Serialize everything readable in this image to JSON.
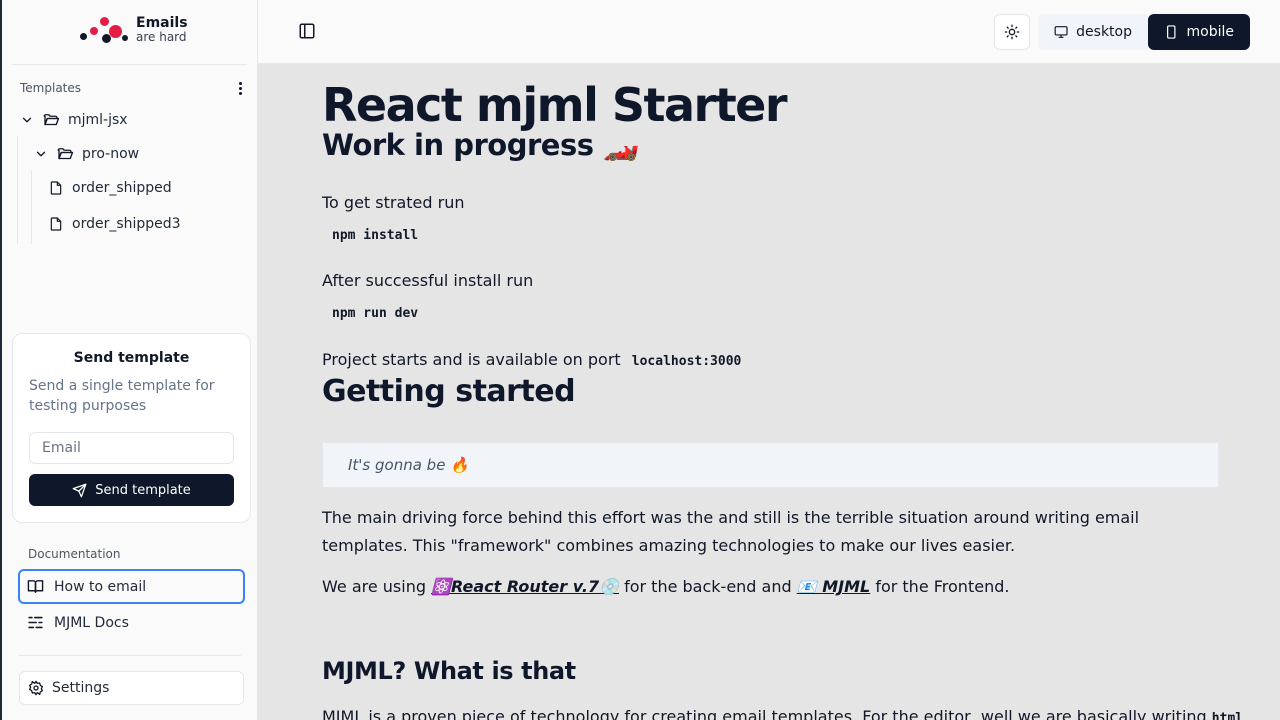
{
  "brand": {
    "line1": "Emails",
    "line2": "are hard"
  },
  "sidebar": {
    "templates_label": "Templates",
    "tree": {
      "root": "mjml-jsx",
      "folder": "pro-now",
      "files": [
        "order_shipped",
        "order_shipped3"
      ]
    },
    "send_card": {
      "title": "Send template",
      "description": "Send a single template for testing purposes",
      "email_placeholder": "Email",
      "button_label": "Send template"
    },
    "documentation_label": "Documentation",
    "docs": [
      {
        "label": "How to email",
        "icon": "book-open-icon",
        "active": true
      },
      {
        "label": "MJML Docs",
        "icon": "list-icon",
        "active": false
      }
    ],
    "settings_label": "Settings"
  },
  "topbar": {
    "desktop_label": "desktop",
    "mobile_label": "mobile",
    "selected_view": "mobile"
  },
  "preview": {
    "title": "React mjml Starter",
    "subtitle": "Work in progress 🏎️",
    "step1_text": "To get strated run",
    "step1_code": "npm install",
    "step2_text": "After successful install run",
    "step2_code": "npm run dev",
    "step3_text": "Project starts and is available on port",
    "step3_code": "localhost:3000",
    "getting_started": "Getting started",
    "quote": "It's gonna be 🔥",
    "paragraph": "The main driving force behind this effort was the and still is the terrible situation around writing email templates. This \"framework\" combines amazing technologies to make our lives easier.",
    "using_prefix": "We are using ",
    "link1_pre": "⚛️",
    "link1": "React Router v.7",
    "link1_post": "💿",
    "using_mid": " for the back-end and ",
    "link2_pre": "📧 ",
    "link2": "MJML",
    "using_suffix": " for the Frontend.",
    "mjml_heading": "MJML? What is that",
    "mjml_text_cut": "MJML is a proven piece of technology for creating email templates. For the editor, well we are basically writing",
    "mjml_code_cut": "html"
  },
  "colors": {
    "accent": "#0f172a",
    "focus_ring": "#3b82f6",
    "logo_red": "#e11d48",
    "content_bg": "#e5e5e5"
  }
}
